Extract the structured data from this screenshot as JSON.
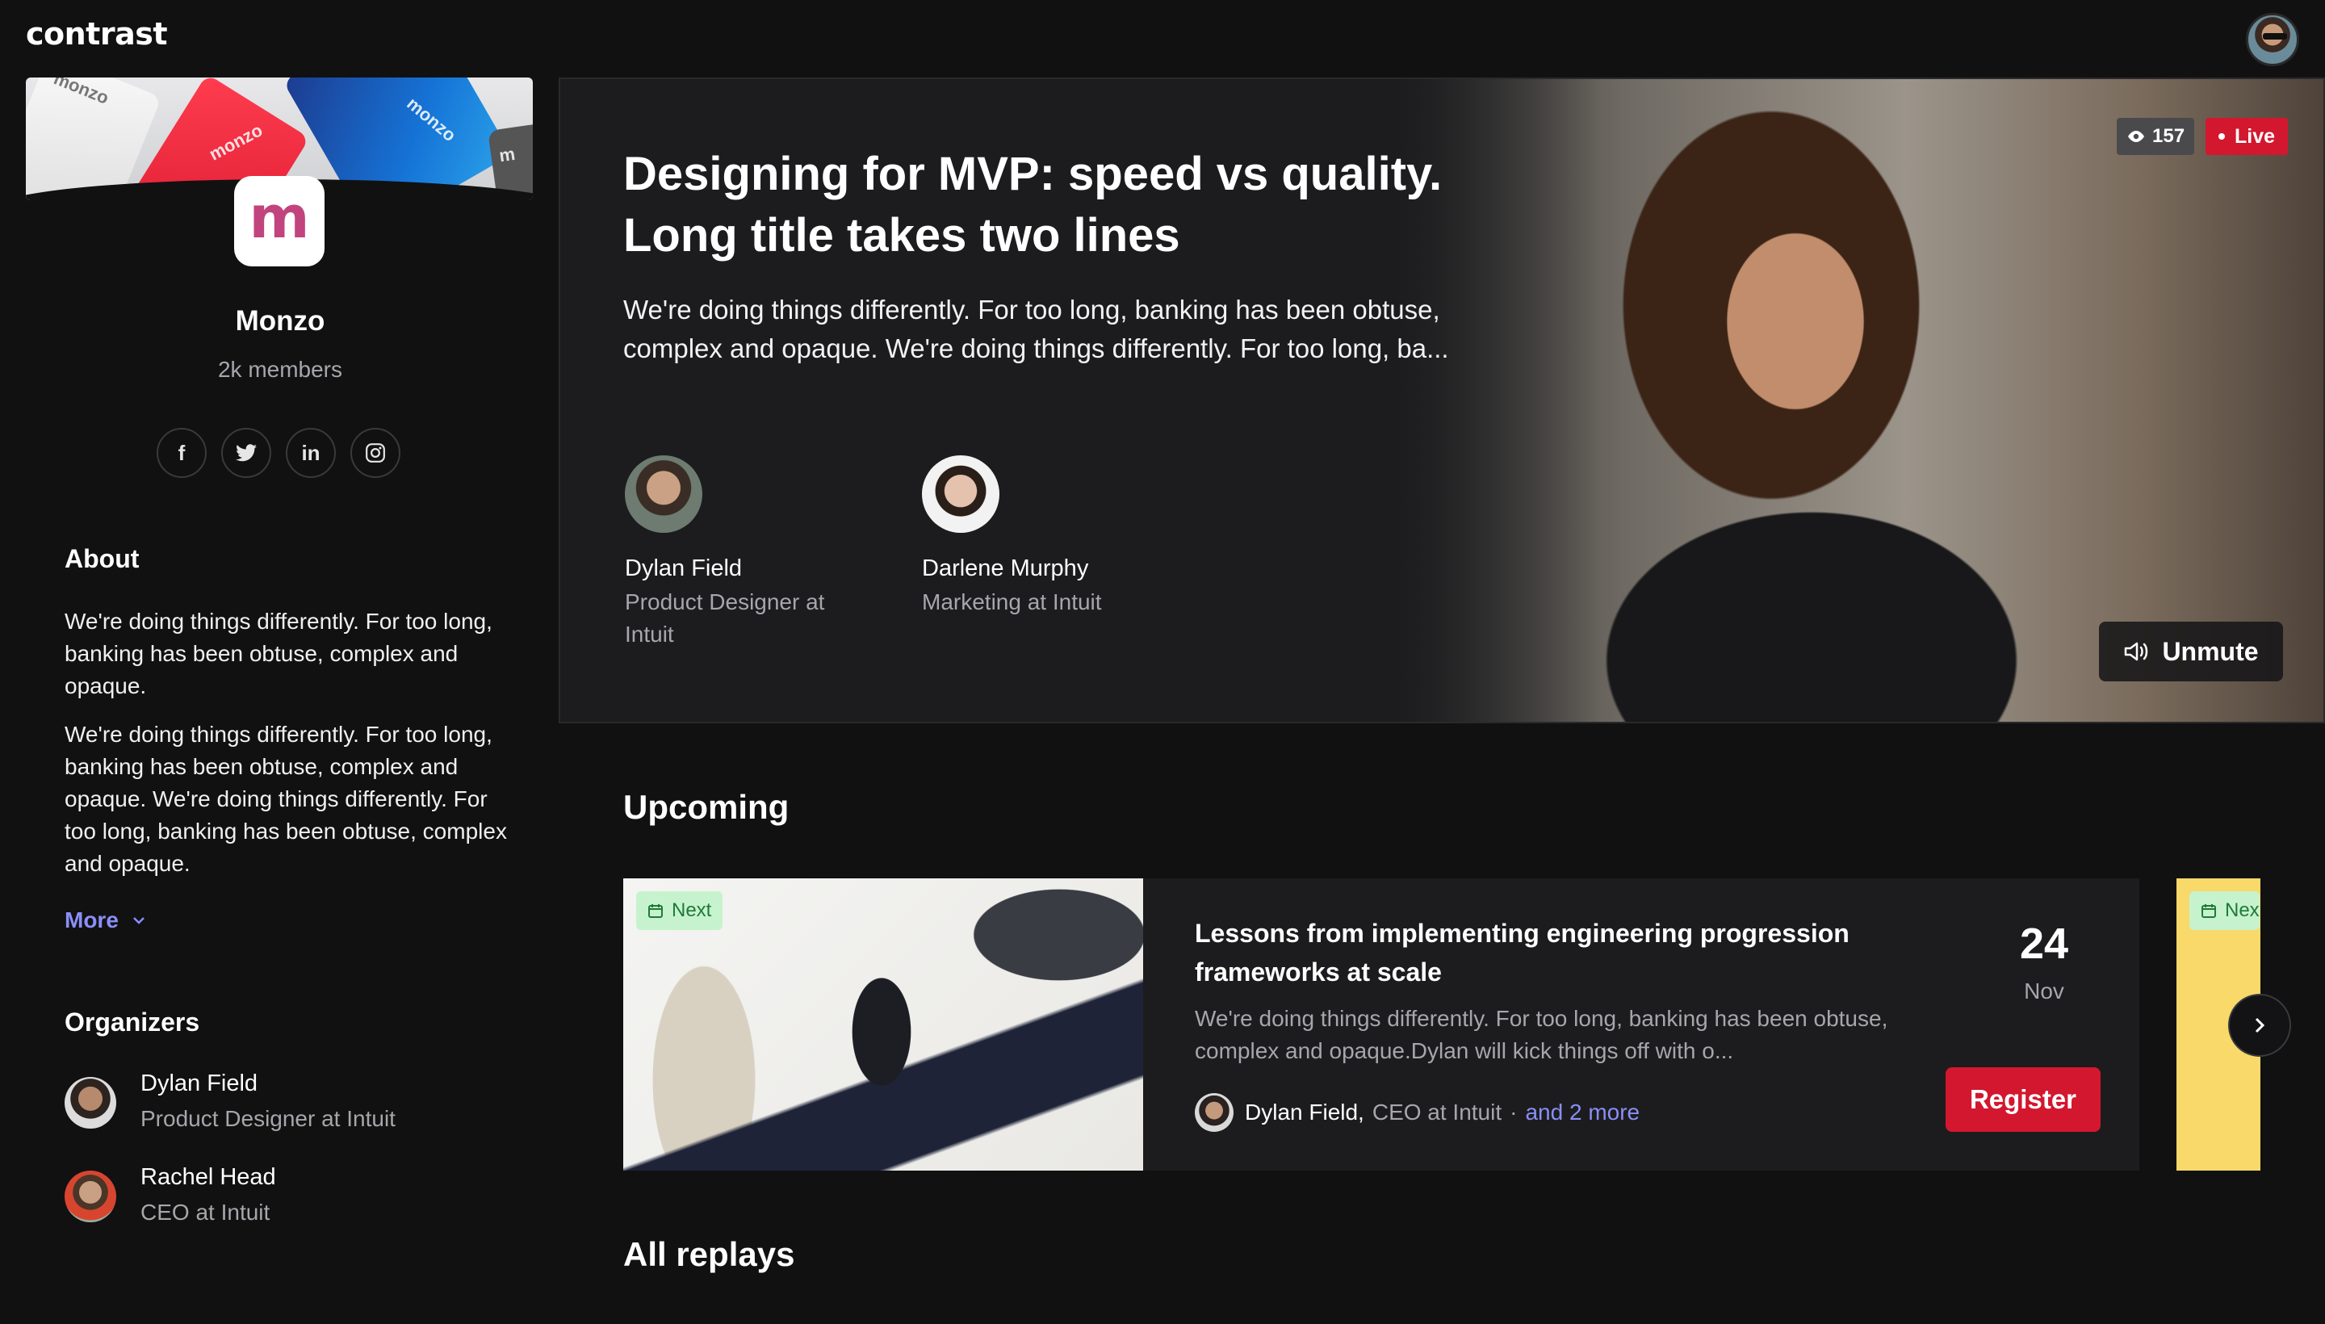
{
  "app": {
    "logo": "contrast"
  },
  "sidebar": {
    "org_name": "Monzo",
    "members": "2k members",
    "banner_texts": [
      "monzo",
      "monzo",
      "monzo",
      "m"
    ],
    "org_logo_letter": "m",
    "socials": [
      {
        "icon": "facebook-icon",
        "glyph": "f"
      },
      {
        "icon": "twitter-icon",
        "glyph": "t"
      },
      {
        "icon": "linkedin-icon",
        "glyph": "in"
      },
      {
        "icon": "instagram-icon",
        "glyph": "◎"
      }
    ],
    "about": {
      "heading": "About",
      "p1": "We're doing things differently. For too long, banking has been obtuse, complex and opaque.",
      "p2": "We're doing things differently. For too long, banking has been obtuse, complex and opaque. We're doing things differently. For too long, banking has been obtuse, complex and opaque.",
      "more": "More"
    },
    "organizers": {
      "heading": "Organizers",
      "items": [
        {
          "name": "Dylan Field",
          "role": "Product Designer at Intuit"
        },
        {
          "name": "Rachel Head",
          "role": "CEO at Intuit"
        }
      ]
    }
  },
  "hero": {
    "title": "Designing for MVP: speed vs quality. Long title takes two lines",
    "description": "We're doing things differently. For too long, banking has been obtuse, complex and opaque. We're doing things differently. For too long, ba...",
    "views": "157",
    "live": "Live",
    "unmute": "Unmute",
    "speakers": [
      {
        "name": "Dylan Field",
        "role": "Product Designer at Intuit"
      },
      {
        "name": "Darlene Murphy",
        "role": "Marketing at Intuit"
      }
    ]
  },
  "upcoming": {
    "heading": "Upcoming",
    "event": {
      "tag": "Next",
      "title": "Lessons from implementing engineering progression frameworks at scale",
      "description": "We're doing things differently. For too long, banking has been obtuse, complex and opaque.Dylan will kick things off with o...",
      "host_name": "Dylan Field,",
      "host_role": "CEO at Intuit",
      "separator": "·",
      "more": "and 2 more",
      "day": "24",
      "month": "Nov",
      "register": "Register"
    },
    "peek_tag": "Nex"
  },
  "replays": {
    "heading": "All replays"
  },
  "colors": {
    "accent": "#d3172e",
    "link": "#8a8ff7",
    "tag_bg": "#c6f3cd",
    "tag_fg": "#1f7a3a"
  }
}
